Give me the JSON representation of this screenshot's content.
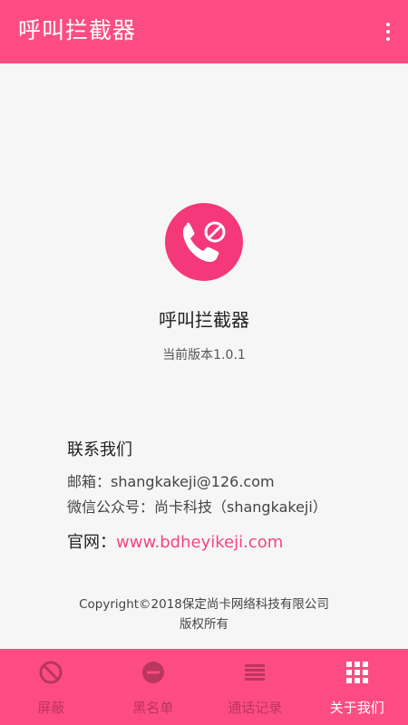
{
  "header": {
    "title": "呼叫拦截器"
  },
  "about": {
    "app_name": "呼叫拦截器",
    "version": "当前版本1.0.1"
  },
  "contact": {
    "title": "联系我们",
    "email": "邮箱：shangkakeji@126.com",
    "wechat": "微信公众号：尚卡科技（shangkakeji）",
    "website_label": "官网：",
    "website_url": "www.bdheyikeji.com"
  },
  "copyright": {
    "line1": "Copyright©2018保定尚卡网络科技有限公司",
    "line2": "版权所有"
  },
  "nav": {
    "items": [
      {
        "label": "屏蔽",
        "icon": "block-icon"
      },
      {
        "label": "黑名单",
        "icon": "minus-circle-icon"
      },
      {
        "label": "通话记录",
        "icon": "list-icon"
      },
      {
        "label": "关于我们",
        "icon": "grid-icon"
      }
    ],
    "active_index": 3
  },
  "colors": {
    "primary": "#fd4c84",
    "inactive_nav": "#bb3561",
    "link": "#f2477f"
  }
}
